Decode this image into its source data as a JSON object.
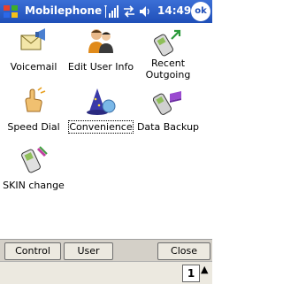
{
  "window": {
    "title": "Mobilephone",
    "time": "14:49",
    "ok_label": "ok"
  },
  "icons": [
    {
      "label": "Voicemail",
      "icon": "voicemail-icon"
    },
    {
      "label": "Edit User Info",
      "icon": "edit-user-icon"
    },
    {
      "label": "Recent Outgoing",
      "icon": "phone-outgoing-icon"
    },
    {
      "label": "Speed Dial",
      "icon": "speed-dial-icon"
    },
    {
      "label": "Convenience",
      "icon": "wizard-icon",
      "selected": true
    },
    {
      "label": "Data Backup",
      "icon": "data-backup-icon"
    },
    {
      "label": "SKIN change",
      "icon": "skin-phone-icon"
    }
  ],
  "commands": {
    "control": "Control",
    "user": "User",
    "close": "Close"
  },
  "input_panel": {
    "indicator": "1"
  }
}
